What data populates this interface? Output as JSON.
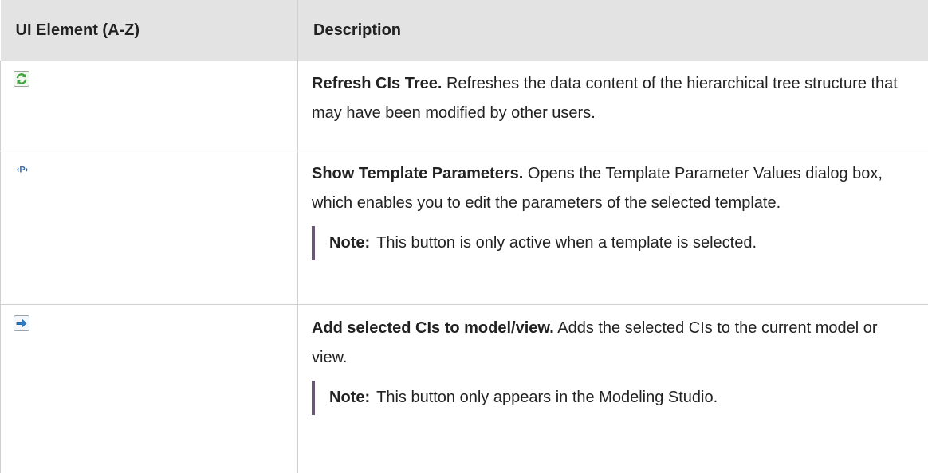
{
  "table": {
    "headers": {
      "element": "UI Element (A-Z)",
      "description": "Description"
    },
    "rows": [
      {
        "icon": "refresh-icon",
        "term": "Refresh CIs Tree.",
        "description": "Refreshes the data content of the hierarchical tree structure that may have been modified by other users."
      },
      {
        "icon": "template-parameters-icon",
        "term": "Show Template Parameters.",
        "description": "Opens the Template Parameter Values dialog box, which enables you to edit the parameters of the selected template.",
        "note_label": "Note:",
        "note_text": "This button is only active when a template is selected."
      },
      {
        "icon": "add-arrow-icon",
        "term": "Add selected CIs to model/view.",
        "description": "Adds the selected CIs to the current model or view.",
        "note_label": "Note:",
        "note_text": "This button only appears in the Modeling Studio."
      }
    ]
  },
  "colors": {
    "header_bg": "#e3e3e3",
    "note_bar": "#6b5876",
    "refresh_green": "#3fa33f",
    "arrow_blue": "#2f7fc8"
  }
}
